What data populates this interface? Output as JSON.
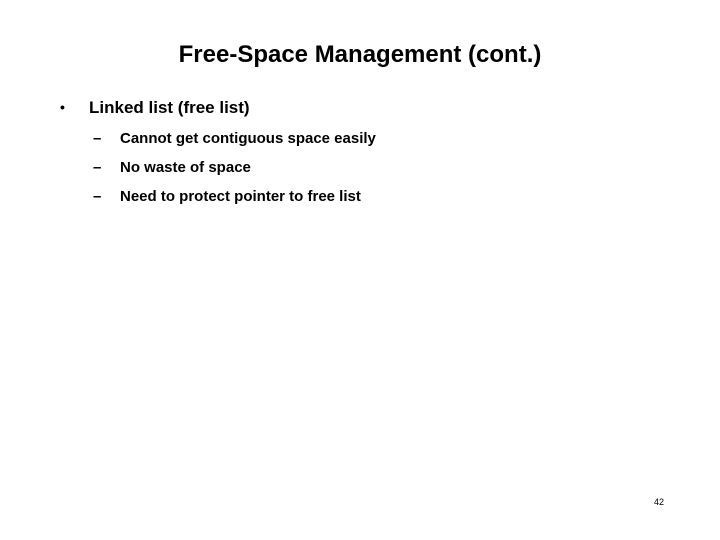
{
  "slide": {
    "title": "Free-Space Management (cont.)",
    "page_number": "42",
    "text_color": "#000000",
    "background_color": "#ffffff",
    "bullets": [
      {
        "level": 1,
        "marker": "•",
        "text": "Linked list (free list)"
      },
      {
        "level": 2,
        "marker": "–",
        "text": "Cannot get contiguous space easily"
      },
      {
        "level": 2,
        "marker": "–",
        "text": "No waste of space"
      },
      {
        "level": 2,
        "marker": "–",
        "text": "Need to protect pointer to free list"
      }
    ]
  }
}
